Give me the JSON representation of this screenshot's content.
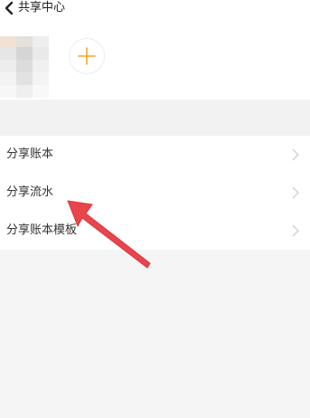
{
  "header": {
    "title": "共享中心",
    "back_icon": "chevron-left-icon"
  },
  "members": {
    "add_icon": "plus-icon"
  },
  "menu": {
    "items": [
      {
        "label": "分享账本"
      },
      {
        "label": "分享流水"
      },
      {
        "label": "分享账本模板"
      }
    ]
  },
  "colors": {
    "accent": "#f5a623",
    "annotation_arrow": "#e8454d"
  }
}
